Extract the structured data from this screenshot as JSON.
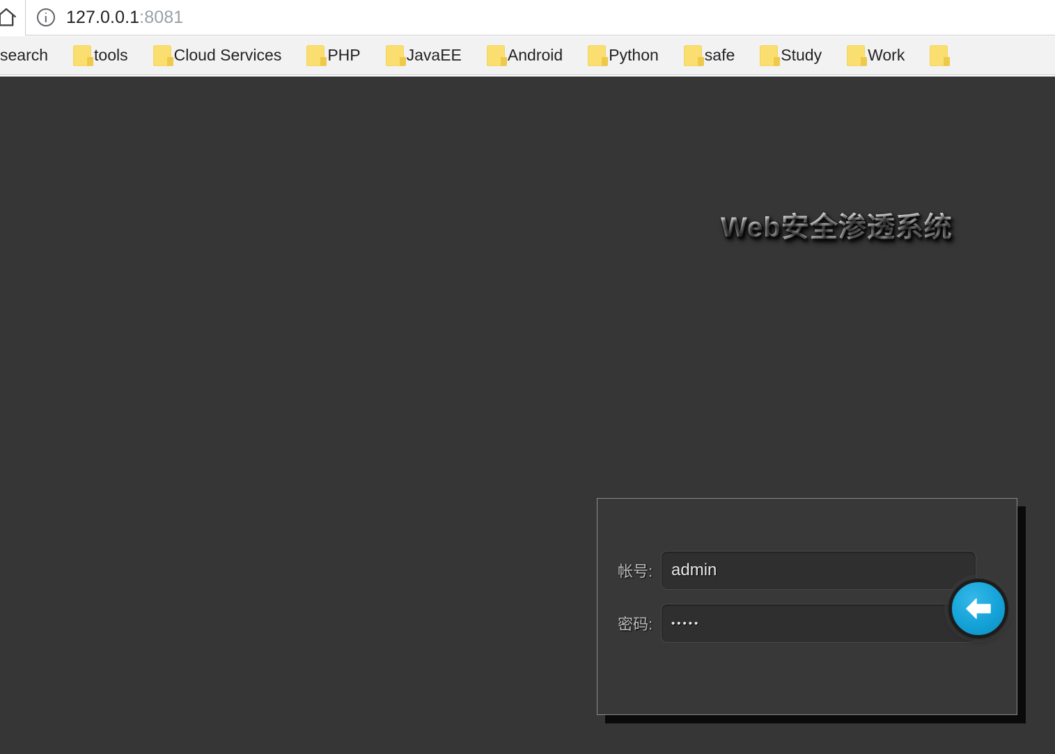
{
  "browser": {
    "home_icon": "home-icon",
    "security_icon": "info-icon",
    "url_host": "127.0.0.1",
    "url_port": ":8081",
    "bookmarks": [
      {
        "label": "search",
        "icon": "folder-icon",
        "clipped_left": true
      },
      {
        "label": "tools",
        "icon": "folder-icon"
      },
      {
        "label": "Cloud Services",
        "icon": "folder-icon"
      },
      {
        "label": "PHP",
        "icon": "folder-icon"
      },
      {
        "label": "JavaEE",
        "icon": "folder-icon"
      },
      {
        "label": "Android",
        "icon": "folder-icon"
      },
      {
        "label": "Python",
        "icon": "folder-icon"
      },
      {
        "label": "safe",
        "icon": "folder-icon"
      },
      {
        "label": "Study",
        "icon": "folder-icon"
      },
      {
        "label": "Work",
        "icon": "folder-icon"
      },
      {
        "label": "",
        "icon": "folder-icon"
      }
    ]
  },
  "page": {
    "background_color": "#363636",
    "title": "Web安全渗透系统"
  },
  "login": {
    "panel_border_color": "#8c8c8c",
    "panel_background": "#383838",
    "username": {
      "label": "帐号:",
      "value": "admin",
      "placeholder": ""
    },
    "password": {
      "label": "密码:",
      "value": "•••••",
      "placeholder": ""
    },
    "submit": {
      "icon": "arrow-left-icon",
      "color": "#14a2d8",
      "label": ""
    }
  }
}
